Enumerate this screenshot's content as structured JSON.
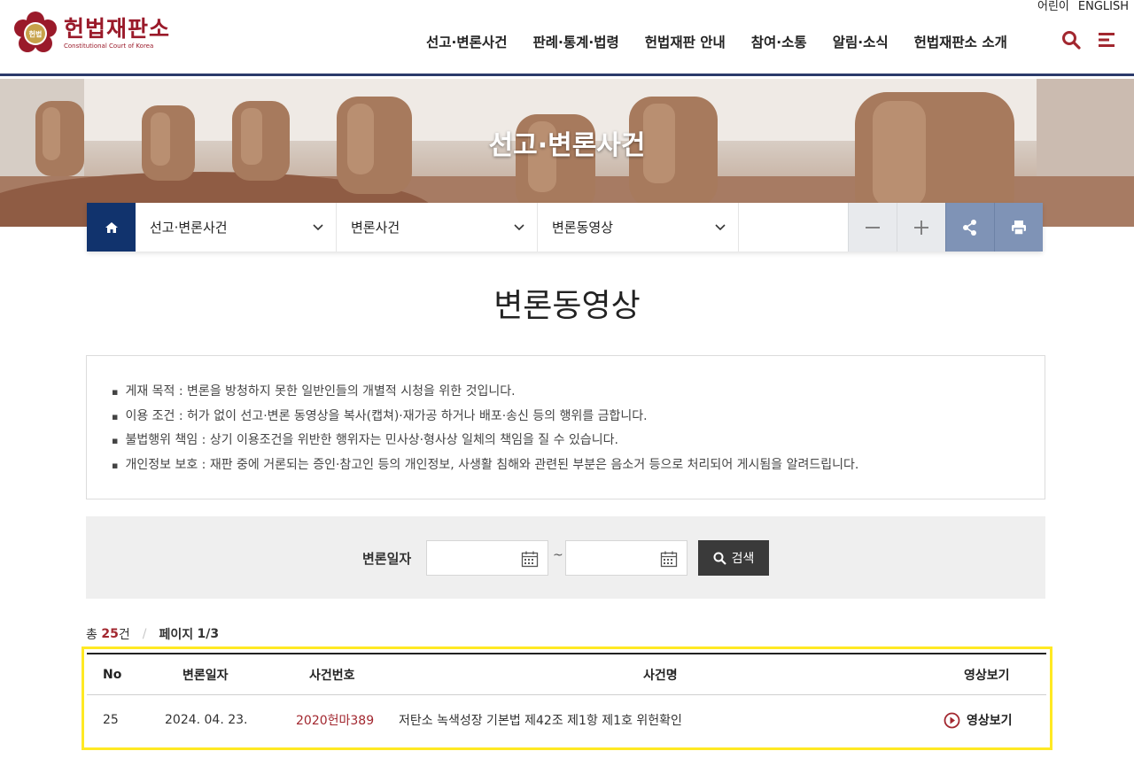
{
  "header": {
    "utility_links": [
      "어린이",
      "ENGLISH"
    ],
    "logo_ko": "헌법재판소",
    "logo_en": "Constitutional Court of Korea",
    "seal_text": "헌법",
    "nav": [
      "선고·변론사건",
      "판례·통계·법령",
      "헌법재판 안내",
      "참여·소통",
      "알림·소식",
      "헌법재판소 소개"
    ],
    "icons": [
      "search-icon",
      "menu-icon"
    ]
  },
  "banner": {
    "title": "선고·변론사건"
  },
  "breadcrumb": {
    "items": [
      "선고·변론사건",
      "변론사건",
      "변론동영상"
    ],
    "tools": [
      "zoom-out-icon",
      "zoom-in-icon",
      "share-icon",
      "print-icon"
    ]
  },
  "page": {
    "title": "변론동영상"
  },
  "notice": [
    "게재 목적 : 변론을 방청하지 못한 일반인들의 개별적 시청을 위한 것입니다.",
    "이용 조건 : 허가 없이 선고·변론 동영상을 복사(캡쳐)·재가공 하거나 배포·송신 등의 행위를 금합니다.",
    "불법행위 책임 : 상기 이용조건을 위반한 행위자는 민사상·형사상 일체의 책임을 질 수 있습니다.",
    "개인정보 보호 : 재판 중에 거론되는 증인·참고인 등의 개인정보, 사생활 침해와 관련된 부분은 음소거 등으로 처리되어 게시됨을 알려드립니다."
  ],
  "search": {
    "label": "변론일자",
    "start_date": "",
    "end_date": "",
    "separator": "~",
    "button": "검색"
  },
  "count": {
    "total_prefix": "총",
    "total": "25",
    "total_suffix": "건",
    "page_label": "페이지",
    "page": "1/3"
  },
  "table": {
    "headers": [
      "No",
      "변론일자",
      "사건번호",
      "사건명",
      "영상보기"
    ],
    "rows": [
      {
        "no": "25",
        "date": "2024. 04. 23.",
        "case_no": "2020헌마389",
        "case_name": "저탄소 녹색성장 기본법 제42조 제1항 제1호 위헌확인",
        "video": "영상보기"
      }
    ]
  },
  "colors": {
    "brand_red": "#9a1a2a",
    "navy": "#11336d",
    "highlight": "#ffe923"
  }
}
